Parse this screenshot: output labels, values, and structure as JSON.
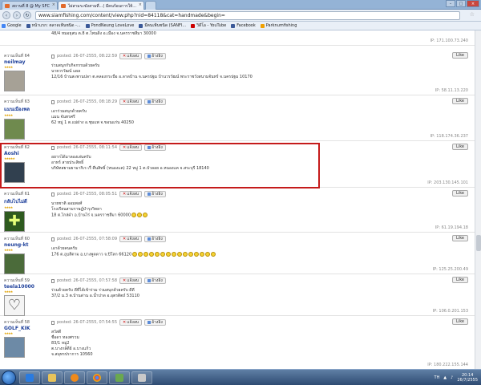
{
  "browser": {
    "tabs": [
      {
        "label": "สถานที่ 8 @ My SFC"
      },
      {
        "label": "ไผ่สามระฆังสามที่...( มีคนร้อนการให้..."
      }
    ],
    "url": "www.siamfishing.com/content/view.php?nid=84118&cat=handmade&begin=",
    "bookmarks": [
      {
        "label": "Google",
        "color": "#4285f4"
      },
      {
        "label": "หน้าแรก: ตลาดเฟ้นชนิด -...",
        "color": "#3b5998"
      },
      {
        "label": "PondNeung LoveLove",
        "color": "#3b5998"
      },
      {
        "label": "มีตนเฟ้นชนิด (SANFI...",
        "color": "#3b5998"
      },
      {
        "label": "วิดีโอ - YouTube",
        "color": "#cc0000"
      },
      {
        "label": "Facebook",
        "color": "#3b5998"
      },
      {
        "label": "Parknumfishing",
        "color": "#f0a000"
      }
    ]
  },
  "labels": {
    "like": "Like",
    "report": "แจ้งลบ",
    "quote": "อ้างอิง"
  },
  "top_fragment": {
    "text": "48/4 หมอธุสน ต.8 ต.โพนดิ่ง อ.เมือง จ.นครราชสีมา 30000",
    "ip": "IP: 171.100.73.240"
  },
  "posts": [
    {
      "num": "ความเห็นที่ 64",
      "user": "neilmay",
      "meta": "posted: 26-07-2555, 08:22:59",
      "lines": [
        "ร่วมสนุกกับกิจกรรมด้วยครับ",
        "นายวรวัฒน์ แผล",
        "12/16 บ้านสะพานปลา ต.คลองกระบือ อ.ลาดบ้าน จ.นครปฐม บ้านวรวัฒน์ พระราชวังสนามจันทร์ จ.นครปฐม 10170"
      ],
      "ip": "IP: 58.11.13.220"
    },
    {
      "num": "ความเห็นที่ 63",
      "user": "แมนเมืองพล",
      "meta": "posted: 26-07-2555, 08:18:29",
      "lines": [
        "เอาร่วมสนุกด้วยครับ",
        "แมน จันทรศรี",
        "62 หมู่ 1 ต.แม่ฝาง อ.ชุมแพ จ.ขอนแก่น 40250"
      ],
      "ip": "IP: 118.174.36.237"
    },
    {
      "num": "ความเห็นที่ 62",
      "user": "Aoshi",
      "meta": "posted: 26-07-2555, 08:11:54",
      "lines": [
        "อยากได้มาลองเล่นครับ",
        "อาทร์ สายประสิทธิ์",
        "บริษัทสยามยามากิเร เรื่ คืนสิทธิ์ (หนองแค) 22 หมู่ 1 ต.บัวลอย อ.หนองแค จ.สระบุรี 18140"
      ],
      "ip": "IP: 203.130.145.101"
    },
    {
      "num": "ความเห็นที่ 61",
      "user": "กลับไปไม่ดี",
      "meta": "posted: 26-07-2555, 08:05:51",
      "lines": [
        "นายชาติ ออมพงศ์",
        "โรงเรียนสามราษฎ์บำรุงวิทยา",
        "18 ต.ไกล่ฝ่า อ.บ้านไร่ จ.นครราชสีมา 60000"
      ],
      "ip": "IP: 61.19.194.18"
    },
    {
      "num": "ความเห็นที่ 60",
      "user": "neung-kt",
      "meta": "posted: 26-07-2555, 07:58:09",
      "lines": [
        "เอาด้วยคนครับ",
        "176 ต.อุบลีตาม อ.บางพูดดาว จ.ปิโลก 66120"
      ],
      "ip": "IP: 125.25.200.49"
    },
    {
      "num": "ความเห็นที่ 59",
      "user": "teela10000",
      "meta": "posted: 26-07-2555, 07:57:58",
      "lines": [
        "ร่วมด้วยครับ ดีที่ได้เข้าร่วม ร่วมสนุกด้วยครับ ดีดี",
        "37/2 ม.3 ต.บ้านด่าน อ.น้ำปาด อ.อุตรดิตถ์ 53110"
      ],
      "ip": "IP: 106.0.201.153"
    },
    {
      "num": "ความเห็นที่ 58",
      "user": "GOLF_KIK",
      "meta": "posted: 26-07-2555, 07:54:55",
      "lines": [
        "สวัสดี",
        "ชื่อดา ทองศรวม",
        "83/1 หมู่2",
        "ต.บางกล้ดีย์ อ.บางแก้ว",
        "จ.สมุทรปราการ 10560"
      ],
      "ip": "IP: 180.222.155.144"
    }
  ],
  "taskbar": {
    "lang": "TH",
    "time": "20:14",
    "date": "26/7/2555"
  }
}
